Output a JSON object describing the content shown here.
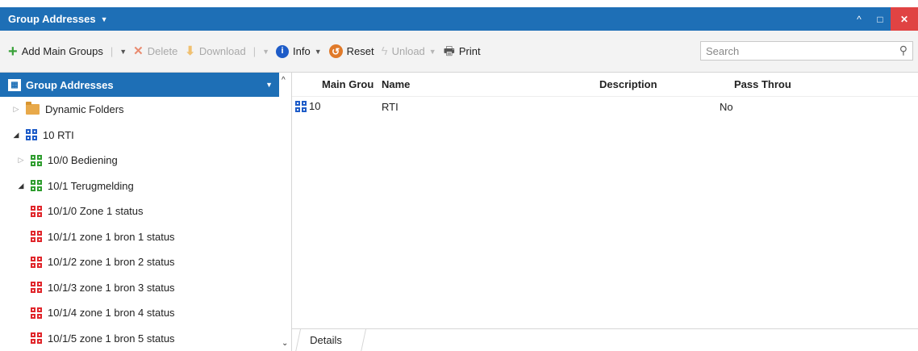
{
  "window": {
    "title": "Group Addresses",
    "buttons": {
      "minimize": "^",
      "maximize": "□",
      "close": "✕"
    }
  },
  "toolbar": {
    "add_main_groups": "Add Main Groups",
    "delete": "Delete",
    "download": "Download",
    "info": "Info",
    "reset": "Reset",
    "unload": "Unload",
    "print": "Print",
    "search_placeholder": "Search"
  },
  "tree": {
    "header": "Group Addresses",
    "items": [
      {
        "label": "Dynamic Folders"
      },
      {
        "label": "10 RTI"
      },
      {
        "label": "10/0 Bediening"
      },
      {
        "label": "10/1 Terugmelding"
      },
      {
        "label": "10/1/0 Zone 1 status"
      },
      {
        "label": "10/1/1 zone 1 bron 1 status"
      },
      {
        "label": "10/1/2 zone 1 bron 2 status"
      },
      {
        "label": "10/1/3 zone 1 bron 3 status"
      },
      {
        "label": "10/1/4 zone 1 bron 4 status"
      },
      {
        "label": "10/1/5 zone 1 bron 5 status"
      }
    ]
  },
  "table": {
    "columns": [
      "Main Grou",
      "Name",
      "Description",
      "Pass Throu"
    ],
    "rows": [
      {
        "main_group": "10",
        "name": "RTI",
        "description": "",
        "pass_through": "No"
      }
    ]
  },
  "tabs": {
    "details": "Details"
  },
  "colors": {
    "accent": "#1e6fb6",
    "close": "#e04343",
    "group_blue": "#1e5cc8",
    "group_green": "#2f9d2f",
    "group_red": "#e0262b",
    "folder": "#e8a94a"
  }
}
